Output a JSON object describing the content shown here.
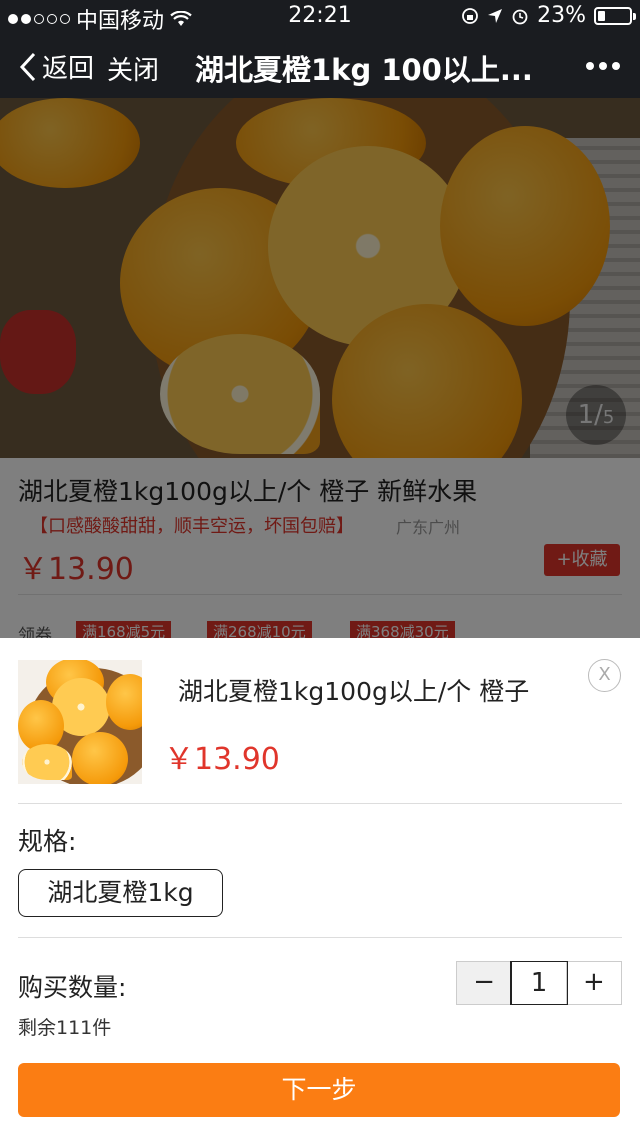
{
  "status_bar": {
    "carrier": "中国移动",
    "time": "22:21",
    "battery": "23%",
    "battery_level": 0.23
  },
  "nav": {
    "back_label": "返回",
    "close_label": "关闭",
    "title": "湖北夏橙1kg 100以上..."
  },
  "gallery": {
    "counter_current": "1",
    "counter_total": "5"
  },
  "product": {
    "title": "湖北夏橙1kg100g以上/个 橙子 新鲜水果",
    "tagline": "【口感酸酸甜甜，顺丰空运，坏国包赔】",
    "origin": "广东广州",
    "price": "￥13.90",
    "favorite_label": "+收藏",
    "coupon_label": "领券",
    "coupons": [
      "满168减5元",
      "满268减10元",
      "满368减30元"
    ]
  },
  "sheet": {
    "title": "湖北夏橙1kg100g以上/个 橙子",
    "price": "￥13.90",
    "close_label": "X",
    "spec_label": "规格:",
    "spec_option": "湖北夏橙1kg",
    "qty_label": "购买数量:",
    "qty_minus": "−",
    "qty_value": "1",
    "qty_plus": "+",
    "stock": "剩余111件",
    "next_label": "下一步"
  },
  "colors": {
    "accent_red": "#e0352b",
    "next_orange": "#fb7d13",
    "nav_bg": "#1a1c20"
  }
}
